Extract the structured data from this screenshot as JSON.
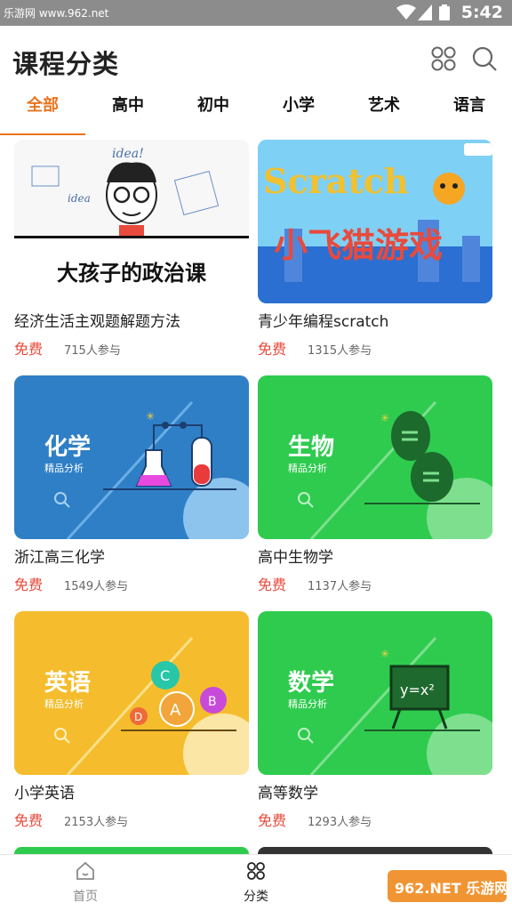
{
  "status_bar": {
    "watermark": "乐游网 www.962.net",
    "time": "5:42"
  },
  "header": {
    "title": "课程分类",
    "grid_icon": "grid-icon",
    "search_icon": "search-icon"
  },
  "tabs": [
    {
      "label": "全部",
      "active": true
    },
    {
      "label": "高中"
    },
    {
      "label": "初中"
    },
    {
      "label": "小学"
    },
    {
      "label": "艺术"
    },
    {
      "label": "语言"
    }
  ],
  "courses": [
    {
      "title": "经济生活主观题解题方法",
      "price": "免费",
      "participants": "715人参与",
      "thumb_text": "大孩子的政治课",
      "thumb_color": "#ffffff"
    },
    {
      "title": "青少年编程scratch",
      "price": "免费",
      "participants": "1315人参与",
      "thumb_text": "Scratch",
      "thumb_text2": "小飞猫游戏",
      "thumb_color": "#5fc3f0"
    },
    {
      "title": "浙江高三化学",
      "price": "免费",
      "participants": "1549人参与",
      "thumb_text": "化学",
      "thumb_sub": "精品分析",
      "thumb_color": "#2f7fc6"
    },
    {
      "title": "高中生物学",
      "price": "免费",
      "participants": "1137人参与",
      "thumb_text": "生物",
      "thumb_sub": "精品分析",
      "thumb_color": "#2fcb4f"
    },
    {
      "title": "小学英语",
      "price": "免费",
      "participants": "2153人参与",
      "thumb_text": "英语",
      "thumb_sub": "精品分析",
      "thumb_color": "#f5bd2d"
    },
    {
      "title": "高等数学",
      "price": "免费",
      "participants": "1293人参与",
      "thumb_text": "数学",
      "thumb_sub": "精品分析",
      "thumb_color": "#2fcb4f"
    }
  ],
  "bottom_nav": [
    {
      "label": "首页",
      "icon": "home-icon"
    },
    {
      "label": "分类",
      "icon": "grid-icon",
      "active": true
    }
  ],
  "watermark_logo": "962.NET 乐游网"
}
